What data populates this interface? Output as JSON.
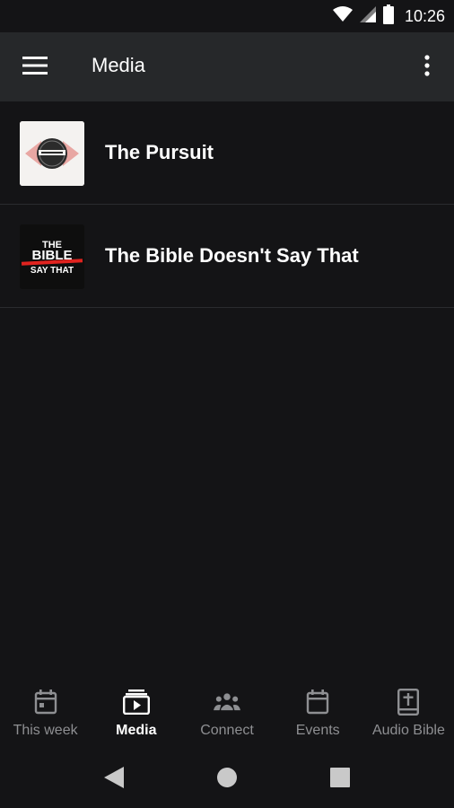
{
  "status_bar": {
    "time": "10:26"
  },
  "app_bar": {
    "title": "Media"
  },
  "media_items": [
    {
      "title": "The Pursuit",
      "thumbnail_icon": "the-pursuit-thumbnail"
    },
    {
      "title": "The Bible Doesn't Say That",
      "thumbnail_icon": "bible-doesnt-say-that-thumbnail",
      "thumbnail_text": [
        "THE",
        "BIBLE",
        "SAY THAT"
      ]
    }
  ],
  "bottom_nav": {
    "items": [
      {
        "label": "This week",
        "icon": "calendar-icon",
        "active": false
      },
      {
        "label": "Media",
        "icon": "media-icon",
        "active": true
      },
      {
        "label": "Connect",
        "icon": "people-icon",
        "active": false
      },
      {
        "label": "Events",
        "icon": "calendar-icon",
        "active": false
      },
      {
        "label": "Audio Bible",
        "icon": "bible-icon",
        "active": false
      }
    ]
  },
  "colors": {
    "background": "#141416",
    "app_bar": "#26282a",
    "inactive": "#8e8f92",
    "active": "#ffffff",
    "accent_red": "#e0231f"
  }
}
